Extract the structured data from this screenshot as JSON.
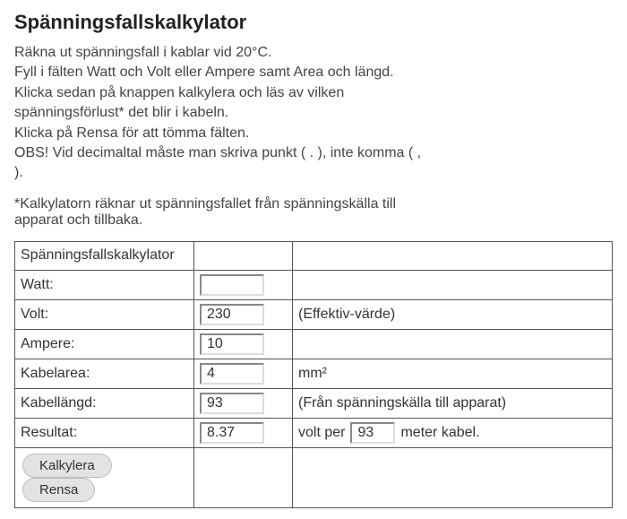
{
  "title": "Spänningsfallskalkylator",
  "intro": {
    "line1": "Räkna ut spänningsfall i kablar vid 20°C.",
    "line2": "Fyll i fälten Watt och Volt eller Ampere samt Area och längd.",
    "line3": "Klicka sedan på knappen kalkylera och läs av vilken spänningsförlust* det blir i kabeln.",
    "line4": "Klicka på Rensa för att tömma fälten.",
    "line5": "OBS! Vid decimaltal måste man skriva punkt ( . ), inte komma ( , )."
  },
  "footnote": "*Kalkylatorn räknar ut spänningsfallet från spänningskälla till apparat och tillbaka.",
  "table": {
    "header": "Spänningsfallskalkylator",
    "rows": {
      "watt": {
        "label": "Watt:",
        "value": "",
        "extra": ""
      },
      "volt": {
        "label": "Volt:",
        "value": "230",
        "extra": "(Effektiv-värde)"
      },
      "ampere": {
        "label": "Ampere:",
        "value": "10",
        "extra": ""
      },
      "kabelarea": {
        "label": "Kabelarea:",
        "value": "4",
        "extra": "mm²"
      },
      "kabellangd": {
        "label": "Kabellängd:",
        "value": "93",
        "extra": "(Från spänningskälla till apparat)"
      },
      "resultat": {
        "label": "Resultat:",
        "value": "8.37",
        "extra_prefix": "volt per",
        "extra_value": "93",
        "extra_suffix": "meter kabel."
      }
    }
  },
  "buttons": {
    "calc": "Kalkylera",
    "reset": "Rensa"
  }
}
